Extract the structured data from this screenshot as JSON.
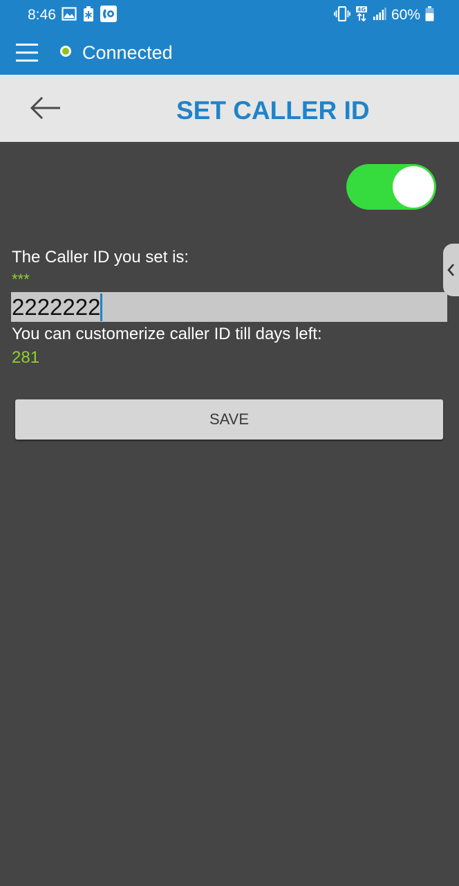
{
  "status_bar": {
    "time": "8:46",
    "battery_percent": "60%",
    "left_icons": [
      "gallery-icon",
      "battery-saver-icon",
      "app-notification-icon"
    ],
    "right_icons": [
      "vibrate-icon",
      "4g-icon",
      "signal-icon",
      "battery-icon"
    ]
  },
  "app_bar": {
    "connection_status": "Connected",
    "connection_color": "#8bc21f",
    "color": "#1f83c9"
  },
  "title_bar": {
    "title": "SET CALLER ID",
    "back_icon": "back-arrow-icon"
  },
  "toggle": {
    "state": "on",
    "color": "#36dc3d"
  },
  "caller_id": {
    "label": "The Caller ID you set is:",
    "masked_value": "***",
    "input_value": "2222222"
  },
  "days": {
    "label": "You can customerize caller ID till days left:",
    "value": "281",
    "accent_color": "#8fd12b"
  },
  "save_button": {
    "label": "SAVE"
  }
}
